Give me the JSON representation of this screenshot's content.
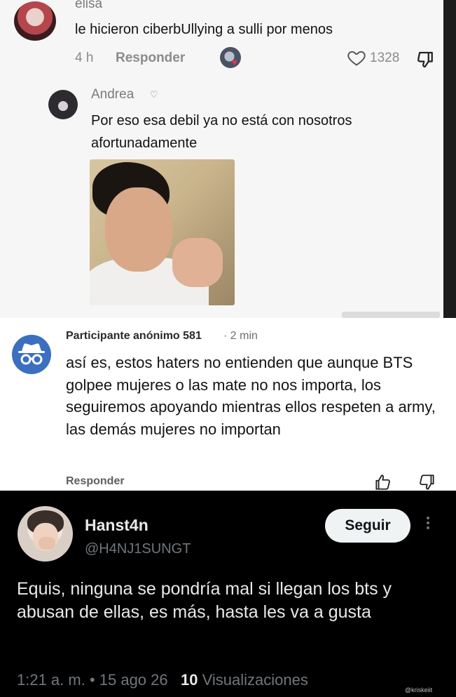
{
  "tiktok": {
    "comment": {
      "author": "elisa",
      "text": "le hicieron ciberbUllying a sulli por menos",
      "time": "4 h",
      "reply_label": "Responder",
      "likes": "1328",
      "icons": [
        "heart-icon",
        "dislike-icon"
      ]
    },
    "reply": {
      "author": "Andrea",
      "author_badge_icon": "heart-icon",
      "text": "Por eso esa debil ya no está con nosotros afortunadamente"
    }
  },
  "forum": {
    "author": "Participante anónimo 581",
    "time": "· 2 min",
    "text": "así es, estos haters no entienden que aunque BTS golpee mujeres o las mate no nos importa, los seguiremos apoyando mientras ellos respeten a army, las demás mujeres no importan",
    "reply_label": "Responder",
    "avatar_color": "#3b6fbf",
    "icons": [
      "thumbs-up-icon",
      "thumbs-down-icon"
    ]
  },
  "tweet": {
    "display_name": "Hanst4n",
    "handle": "@H4NJ1SUNGT",
    "follow_label": "Seguir",
    "text": "Equis, ninguna se pondría mal si llegan los bts y abusan de ellas, es más, hasta les va a gusta",
    "timestamp": "1:21 a. m. • 15 ago 26",
    "views_count": "10",
    "views_label": "Visualizaciones",
    "watermark": "@kriskeiit"
  },
  "colors": {
    "tiktok_bg": "#f6f6f6",
    "tiktok_like_accent": "#fe2c55",
    "forum_bg": "#ffffff",
    "tweet_bg": "#000000",
    "tweet_text": "#e7e9ea",
    "tweet_muted": "#71767b"
  }
}
